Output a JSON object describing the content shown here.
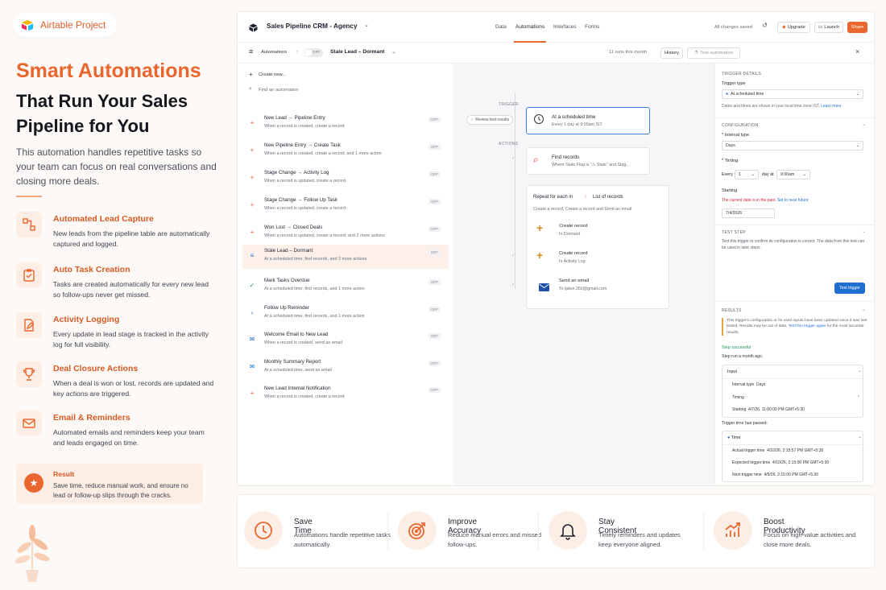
{
  "brand": {
    "name": "Airtable Project"
  },
  "hero": {
    "line1": "Smart Automations",
    "line2": "That Run Your Sales Pipeline for You",
    "desc": "This automation handles repetitive tasks so your team can focus on real conversations and closing more deals."
  },
  "features": [
    {
      "title": "Automated Lead Capture",
      "desc": "New leads from the pipeline table are automatically captured and logged."
    },
    {
      "title": "Auto Task Creation",
      "desc": "Tasks are created automatically for every new lead so follow-ups never get missed."
    },
    {
      "title": "Activity Logging",
      "desc": "Every update in lead stage is tracked in the activity log for full visibility."
    },
    {
      "title": "Deal Closure Actions",
      "desc": "When a deal is won or lost, records are updated and key actions are triggered."
    },
    {
      "title": "Email & Reminders",
      "desc": "Automated emails and reminders keep your team and leads engaged on time."
    }
  ],
  "result": {
    "title": "Result",
    "desc": "Save time, reduce manual work, and ensure no lead or follow-up slips through the cracks."
  },
  "app": {
    "base_name": "Sales Pipeline CRM - Agency",
    "tabs": [
      "Data",
      "Automations",
      "Interfaces",
      "Forms"
    ],
    "saved": "All changes saved",
    "upgrade": "Upgrade",
    "launch": "Launch",
    "share": "Share",
    "crumb_root": "Automations",
    "toggle": "OFF",
    "automation_name": "Stale Lead – Dormant",
    "runs": "11 runs this month",
    "history": "History",
    "test_automation": "Test automation",
    "create_new": "Create new...",
    "find_placeholder": "Find an automation",
    "items": [
      {
        "name": "New Lead → Pipeline Entry",
        "desc": "When a record is created, create a record",
        "status": "OFF"
      },
      {
        "name": "New Pipeline Entry → Create Task",
        "desc": "When a record is created, create a record, and 1 more action",
        "status": "OFF"
      },
      {
        "name": "Stage Change → Activity Log",
        "desc": "When a record is updated, create a record",
        "status": "OFF"
      },
      {
        "name": "Stage Change → Follow Up Task",
        "desc": "When a record is updated, create a record",
        "status": "OFF"
      },
      {
        "name": "Won Lost → Closed Deals",
        "desc": "When a record is updated, create a record, and 2 more actions",
        "status": "OFF"
      },
      {
        "name": "Stale Lead – Dormant",
        "desc": "At a scheduled time, find records, and 3 more actions",
        "status": "OFF"
      },
      {
        "name": "Mark Tasks Overdue",
        "desc": "At a scheduled time, find records, and 1 more action",
        "status": "OFF"
      },
      {
        "name": "Follow Up Reminder",
        "desc": "At a scheduled time, find records, and 1 more action",
        "status": "OFF"
      },
      {
        "name": "Welcome Email to New Lead",
        "desc": "When a record is created, send an email",
        "status": "OFF"
      },
      {
        "name": "Monthly Summary Report",
        "desc": "At a scheduled time, send an email",
        "status": "OFF"
      },
      {
        "name": "New Lead Internal Notification",
        "desc": "When a record is created, create a record",
        "status": "OFF"
      }
    ],
    "canvas": {
      "trigger_label": "TRIGGER",
      "actions_label": "ACTIONS",
      "review": "Review test results",
      "trigger_title": "At a scheduled time",
      "trigger_sub": "Every 1 day at 9:00am IST",
      "find_title": "Find records",
      "find_sub": "Where Stale Flag is \"⚠ Stale\" and Stag...",
      "repeat_prefix": "Repeat for each in",
      "repeat_list": "List of records",
      "repeat_desc": "Create a record, Create a record and Send an email",
      "a1_title": "Create record",
      "a1_sub": "In Dormant",
      "a2_title": "Create record",
      "a2_sub": "In Activity Log",
      "a3_title": "Send an email",
      "a3_sub": "To ijaker.360@gmail.com"
    },
    "panel": {
      "details": "TRIGGER DETAILS",
      "trigger_type_label": "Trigger type",
      "trigger_type": "At scheduled time",
      "tz_note": "Dates and times are shown in your local time zone IST.",
      "learn_more": "Learn more",
      "configuration": "CONFIGURATION",
      "interval_label": "* Interval type",
      "interval": "Days",
      "timing_label": "* Timing",
      "every": "Every",
      "every_val": "1",
      "day_at": "day at",
      "time_val": "9:00am",
      "starting_label": "Starting",
      "past_warn": "The current date is in the past.",
      "set_future": "Set to near future",
      "start_date": "7/4/2026",
      "test_step": "TEST STEP",
      "test_desc": "Test this trigger to confirm its configuration is correct. The data from this test can be used in later steps.",
      "test_btn": "Test trigger",
      "results": "RESULTS",
      "results_warn": "This trigger's configuration or its used inputs have been updated since it was last tested. Results may be out of date.",
      "test_again": "Test this trigger again",
      "results_warn_tail": "for the most accurate results.",
      "step_ok": "Step successful",
      "step_ago": "Step run a month ago.",
      "input": "Input",
      "interval_type_k": "Interval type",
      "interval_type_v": "Days",
      "timing_k": "Timing",
      "starting_k": "Starting",
      "starting_v": "4/7/26, 11:00:00 PM GMT+5:30",
      "passed": "Trigger time has passed:",
      "time": "Time",
      "actual_k": "Actual trigger time",
      "actual_v": "4/10/26, 2:15:57 PM GMT+5:30",
      "expected_k": "Expected trigger time",
      "expected_v": "4/10/26, 2:15:00 PM GMT+5:30",
      "next_k": "Next trigger time",
      "next_v": "4/9/26, 2:15:00 PM GMT+5:30"
    }
  },
  "benefits": [
    {
      "title": "Save Time",
      "desc": "Automations handle repetitive tasks automatically."
    },
    {
      "title": "Improve Accuracy",
      "desc": "Reduce manual errors and missed follow-ups."
    },
    {
      "title": "Stay Consistent",
      "desc": "Timely reminders and updates keep everyone aligned."
    },
    {
      "title": "Boost Productivity",
      "desc": "Focus on high-value activities and close more deals."
    }
  ],
  "colors": {
    "accent": "#e9672e",
    "blue": "#1f6fd1",
    "bg": "#fdf9f6"
  }
}
